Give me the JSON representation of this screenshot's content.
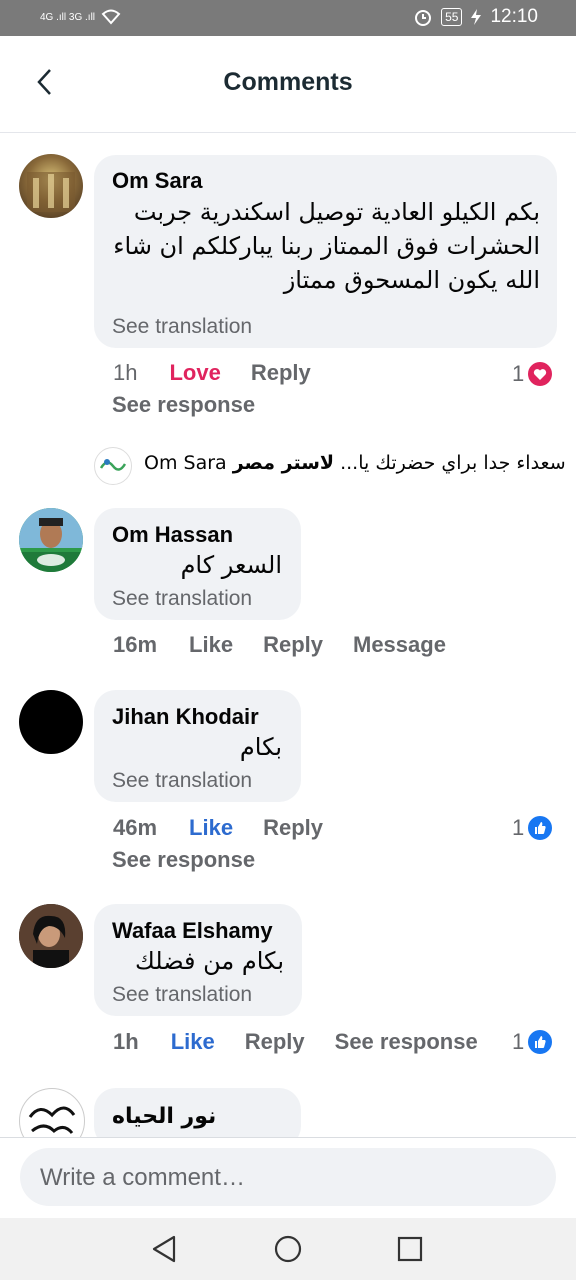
{
  "status": {
    "left_signal": "4G .ıll 3G .ıll",
    "battery": "55",
    "time": "12:10"
  },
  "header": {
    "title": "Comments"
  },
  "comments": [
    {
      "name": "Om Sara",
      "text": "بكم الكيلو العادية توصيل اسكندرية جربت الحشرات فوق الممتاز ربنا يباركلكم ان شاء الله يكون المسحوق ممتاز",
      "translation": "See translation",
      "time": "1h",
      "reaction_action": "Love",
      "reply": "Reply",
      "react_count": "1",
      "see_response": "See response"
    },
    {
      "name": "Om Hassan",
      "text": "السعر كام",
      "translation": "See translation",
      "time": "16m",
      "reaction_action": "Like",
      "reply": "Reply",
      "message": "Message"
    },
    {
      "name": "Jihan Khodair",
      "text": "بكام",
      "translation": "See translation",
      "time": "46m",
      "reaction_action": "Like",
      "reply": "Reply",
      "react_count": "1",
      "see_response": "See response"
    },
    {
      "name": "Wafaa Elshamy",
      "text": "بكام من فضلك",
      "translation": "See translation",
      "time": "1h",
      "reaction_action": "Like",
      "reply": "Reply",
      "see_response": "See response",
      "react_count": "1"
    },
    {
      "name": "نور الحياه"
    }
  ],
  "reply_preview": {
    "author": "لاستر مصر",
    "text": "Om Sara سعداء جدا براي حضرتك يا..."
  },
  "composer": {
    "placeholder": "Write a comment…"
  },
  "colors": {
    "love": "#e0245e",
    "like": "#2d6bcf",
    "bubble": "#f0f2f5"
  }
}
